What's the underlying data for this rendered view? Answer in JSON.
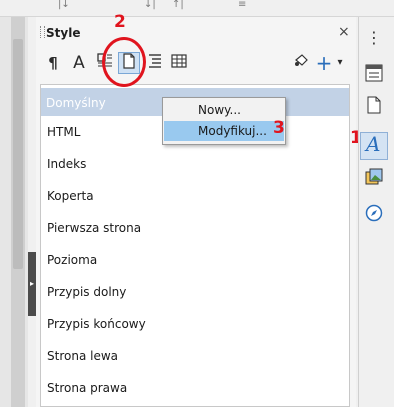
{
  "top_toolbar": {
    "glyphs": [
      "|↓",
      "↓|",
      "↑|",
      "≡"
    ]
  },
  "panel": {
    "title": "Style",
    "close_glyph": "×",
    "toolbar_icons": [
      "paragraph-styles-icon",
      "character-styles-icon",
      "frame-styles-icon",
      "page-styles-icon",
      "list-styles-icon",
      "table-styles-icon",
      "fill-format-icon",
      "new-style-icon",
      "dropdown-arrow-icon"
    ],
    "toolbar_glyphs": {
      "paragraph": "¶",
      "character": "A",
      "add": "+",
      "dropdown": "▾"
    },
    "styles": [
      "Domyślny",
      "HTML",
      "Indeks",
      "Koperta",
      "Pierwsza strona",
      "Pozioma",
      "Przypis dolny",
      "Przypis końcowy",
      "Strona lewa",
      "Strona prawa"
    ],
    "selected_index": 0
  },
  "context_menu": {
    "items": [
      "Nowy...",
      "Modyfikuj..."
    ],
    "highlighted_index": 1
  },
  "annotations": {
    "n1": "1",
    "n2": "2",
    "n3": "3",
    "color": "#e0141e"
  },
  "sidebar": {
    "menu_glyph": "⋮",
    "buttons": [
      "properties-icon",
      "page-icon",
      "styles-icon",
      "gallery-icon",
      "navigator-icon"
    ]
  },
  "colors": {
    "selected_row": "#c2d2e6",
    "menu_highlight": "#99c9ef",
    "accent": "#2a6ebb"
  }
}
